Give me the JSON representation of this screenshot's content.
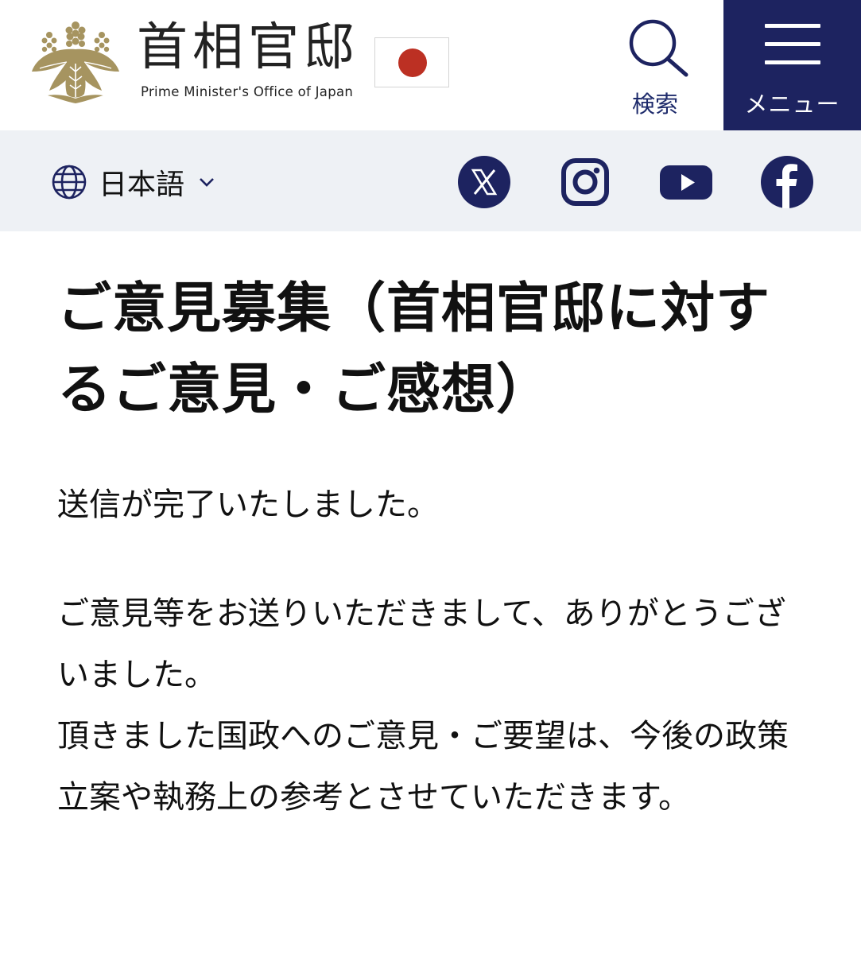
{
  "header": {
    "title": "首相官邸",
    "subtitle": "Prime Minister's Office of Japan",
    "logo_icon": "paulownia-emblem-icon",
    "flag_icon": "japan-flag-icon",
    "search_label": "検索",
    "search_icon": "search-icon",
    "menu_label": "メニュー",
    "menu_icon": "hamburger-icon"
  },
  "subbar": {
    "language_label": "日本語",
    "language_icon": "globe-icon",
    "social": [
      "x-icon",
      "instagram-icon",
      "youtube-icon",
      "facebook-icon"
    ]
  },
  "main": {
    "title": "ご意見募集（首相官邸に対するご意見・ご感想）",
    "message_1": "送信が完了いたしました。",
    "message_2": "ご意見等をお送りいただきまして、ありがとうございました。",
    "message_3": "頂きました国政へのご意見・ご要望は、今後の政策立案や執務上の参考とさせていただきます。"
  },
  "colors": {
    "navy": "#1d2360",
    "gold": "#a69460",
    "flag_red": "#bc3023",
    "subbar_bg": "#eef1f5"
  }
}
